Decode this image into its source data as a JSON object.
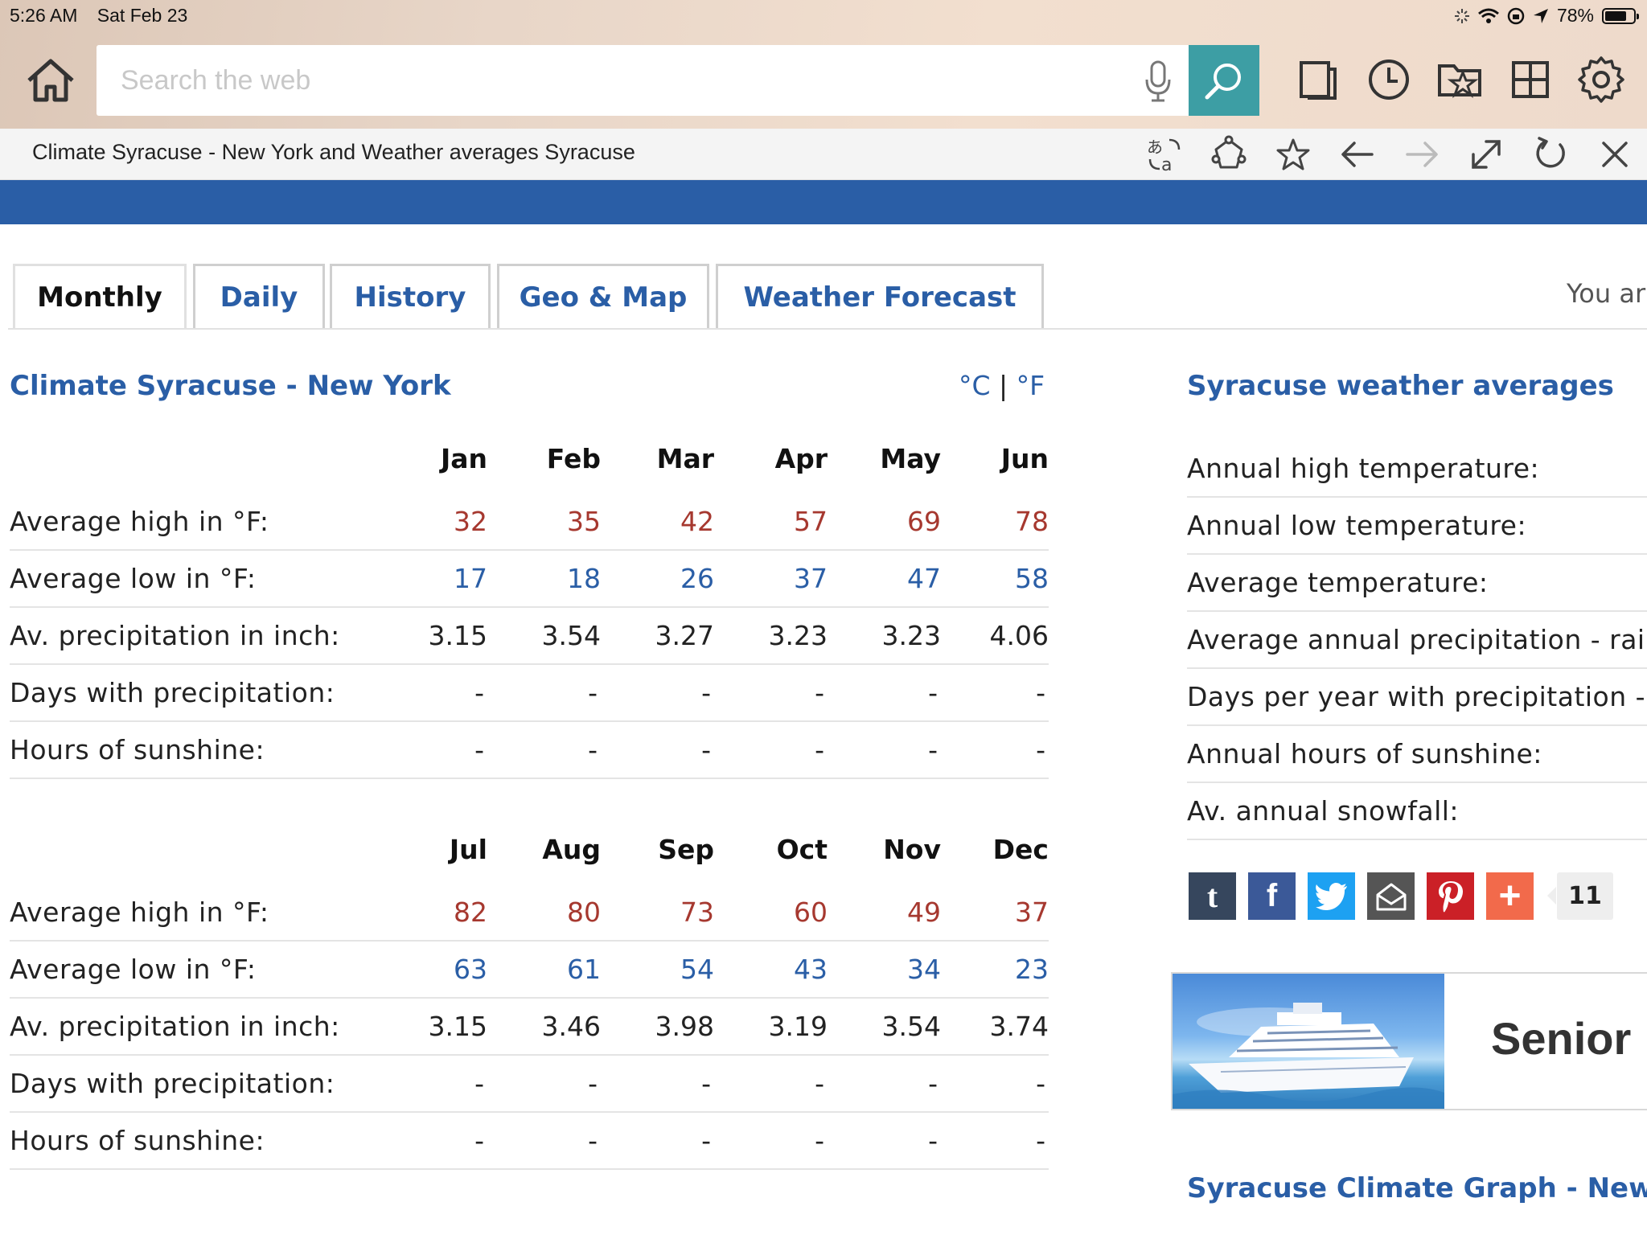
{
  "status_bar": {
    "time": "5:26 AM",
    "date": "Sat Feb 23",
    "battery": "78%"
  },
  "browser": {
    "search_placeholder": "Search the web",
    "page_title": "Climate Syracuse - New York and Weather averages Syracuse"
  },
  "tabs": [
    "Monthly",
    "Daily",
    "History",
    "Geo & Map",
    "Weather Forecast"
  ],
  "you_are_text": "You ar",
  "climate": {
    "title": "Climate Syracuse - New York",
    "unit_c": "°C",
    "unit_sep": "|",
    "unit_f": "°F",
    "row_labels": {
      "high": "Average high in °F:",
      "low": "Average low in °F:",
      "precip": "Av. precipitation in inch:",
      "days": "Days with precipitation:",
      "sun": "Hours of sunshine:"
    },
    "table1": {
      "months": [
        "Jan",
        "Feb",
        "Mar",
        "Apr",
        "May",
        "Jun"
      ],
      "high": [
        "32",
        "35",
        "42",
        "57",
        "69",
        "78"
      ],
      "low": [
        "17",
        "18",
        "26",
        "37",
        "47",
        "58"
      ],
      "precip": [
        "3.15",
        "3.54",
        "3.27",
        "3.23",
        "3.23",
        "4.06"
      ],
      "days": [
        "-",
        "-",
        "-",
        "-",
        "-",
        "-"
      ],
      "sun": [
        "-",
        "-",
        "-",
        "-",
        "-",
        "-"
      ]
    },
    "table2": {
      "months": [
        "Jul",
        "Aug",
        "Sep",
        "Oct",
        "Nov",
        "Dec"
      ],
      "high": [
        "82",
        "80",
        "73",
        "60",
        "49",
        "37"
      ],
      "low": [
        "63",
        "61",
        "54",
        "43",
        "34",
        "23"
      ],
      "precip": [
        "3.15",
        "3.46",
        "3.98",
        "3.19",
        "3.54",
        "3.74"
      ],
      "days": [
        "-",
        "-",
        "-",
        "-",
        "-",
        "-"
      ],
      "sun": [
        "-",
        "-",
        "-",
        "-",
        "-",
        "-"
      ]
    }
  },
  "averages": {
    "title": "Syracuse weather averages",
    "items": [
      "Annual high temperature:",
      "Annual low temperature:",
      "Average temperature:",
      "Average annual precipitation - rainf",
      "Days per year with precipitation - r",
      "Annual hours of sunshine:",
      "Av. annual snowfall:"
    ]
  },
  "share": {
    "count": "11",
    "tumblr_glyph": "t",
    "facebook_glyph": "f",
    "plus_glyph": "+"
  },
  "ad": {
    "text": "Senior"
  },
  "graph_title": "Syracuse Climate Graph - New Y",
  "colors": {
    "brand_blue": "#2a5ea6",
    "high_red": "#a6382f",
    "search_teal": "#3d9ea4"
  }
}
